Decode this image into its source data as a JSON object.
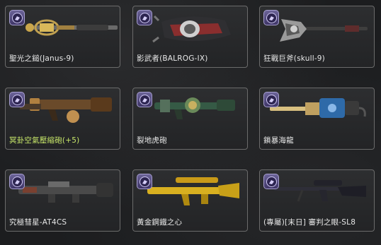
{
  "grid": {
    "items": [
      {
        "label": "聖光之鎚(Janus-9)",
        "icon": "janus-mace-icon",
        "highlight": false
      },
      {
        "label": "影武者(BALROG-IX)",
        "icon": "balrog-gauntlet-icon",
        "highlight": false
      },
      {
        "label": "狂戰巨斧(skull-9)",
        "icon": "skull-axe-icon",
        "highlight": false
      },
      {
        "label": "冥卦空氣壓縮砲(+5)",
        "icon": "air-cannon-icon",
        "highlight": true
      },
      {
        "label": "裂地虎砲",
        "icon": "tiger-cannon-icon",
        "highlight": false
      },
      {
        "label": "鎖暴海龍",
        "icon": "sea-dragon-drill-icon",
        "highlight": false
      },
      {
        "label": "究極彗星-AT4CS",
        "icon": "comet-launcher-icon",
        "highlight": false
      },
      {
        "label": "黃金鋼鐵之心",
        "icon": "golden-rifle-icon",
        "highlight": false
      },
      {
        "label": "(專屬)[末日] 審判之眼-SL8",
        "icon": "sniper-rifle-icon",
        "highlight": false
      }
    ],
    "badge_icon": "grade-emblem-icon",
    "colors": {
      "name": "#e8e8e8",
      "highlight": "#c9e86a",
      "border": "#6b6b6b",
      "badge": "#5a4f8a"
    }
  }
}
